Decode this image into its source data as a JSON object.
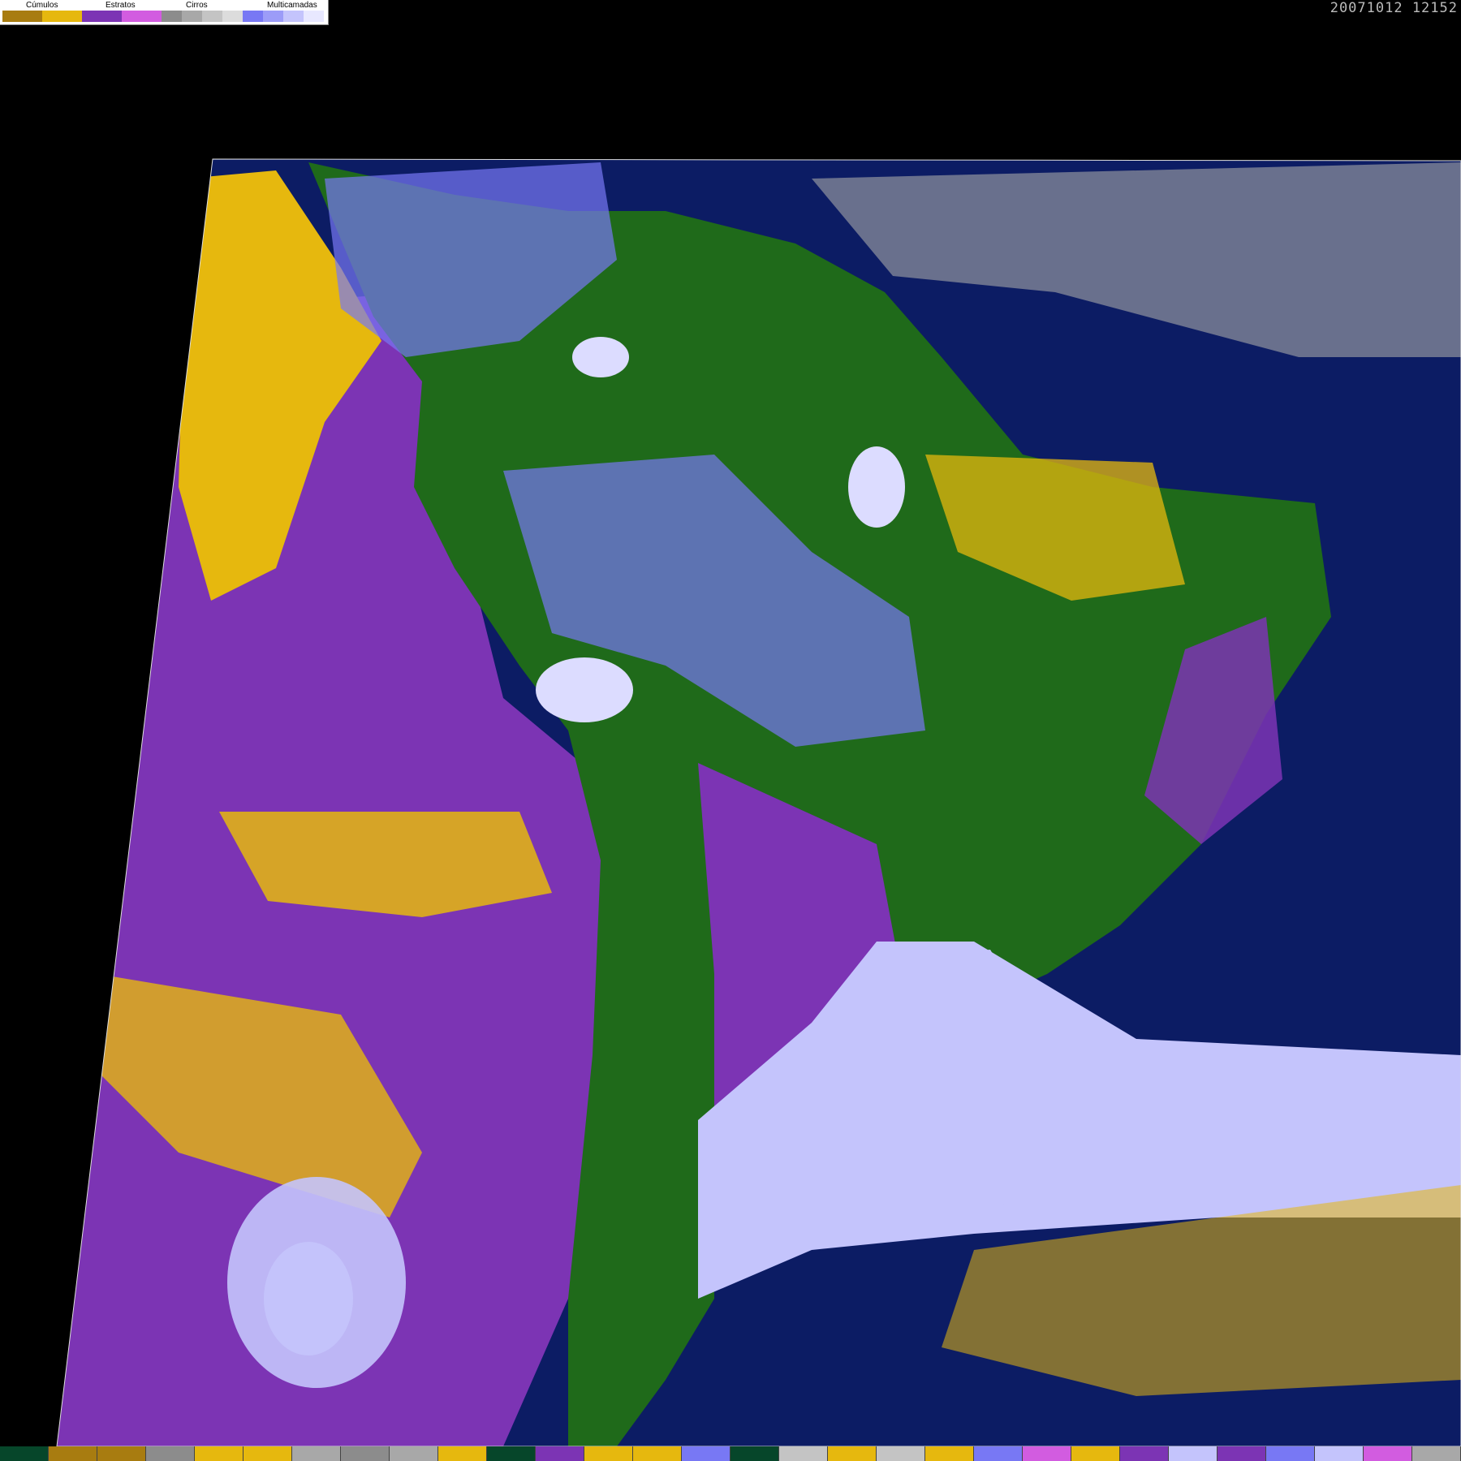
{
  "timestamp": "20071012 12152",
  "legend": {
    "groups": [
      {
        "label": "Cúmulos",
        "colors": [
          "#a87c10",
          "#e6b80e"
        ]
      },
      {
        "label": "Estratos",
        "colors": [
          "#7c34b4",
          "#d25ce0"
        ]
      },
      {
        "label": "Cirros",
        "colors": [
          "#8c8c8c",
          "#a8a8a8",
          "#c4c4c4",
          "#dcdcdc"
        ]
      },
      {
        "label": "Multicamadas",
        "colors": [
          "#7878f4",
          "#9c9cf8",
          "#c4c4fc",
          "#e8e8ff"
        ]
      }
    ]
  },
  "map": {
    "ocean_color": "#0c1c64",
    "land_color": "#1f6a1a",
    "stratus_color": "#7c34b4",
    "cumulus_color": "#e6b80e",
    "multilayer_color": "#c4c4fc"
  },
  "bottom_strip": {
    "colors": [
      "#06462a",
      "#a87c10",
      "#a87c10",
      "#8c8c8c",
      "#e6b80e",
      "#e6b80e",
      "#a8a8a8",
      "#8c8c8c",
      "#a8a8a8",
      "#e6b80e",
      "#06462a",
      "#7c34b4",
      "#e6b80e",
      "#e6b80e",
      "#7878f4",
      "#06462a",
      "#c4c4c4",
      "#e6b80e",
      "#c4c4c4",
      "#e6b80e",
      "#7878f4",
      "#d25ce0",
      "#e6b80e",
      "#7c34b4",
      "#c4c4fc",
      "#7c34b4",
      "#7878f4",
      "#c4c4fc",
      "#d25ce0",
      "#a8a8a8"
    ]
  }
}
